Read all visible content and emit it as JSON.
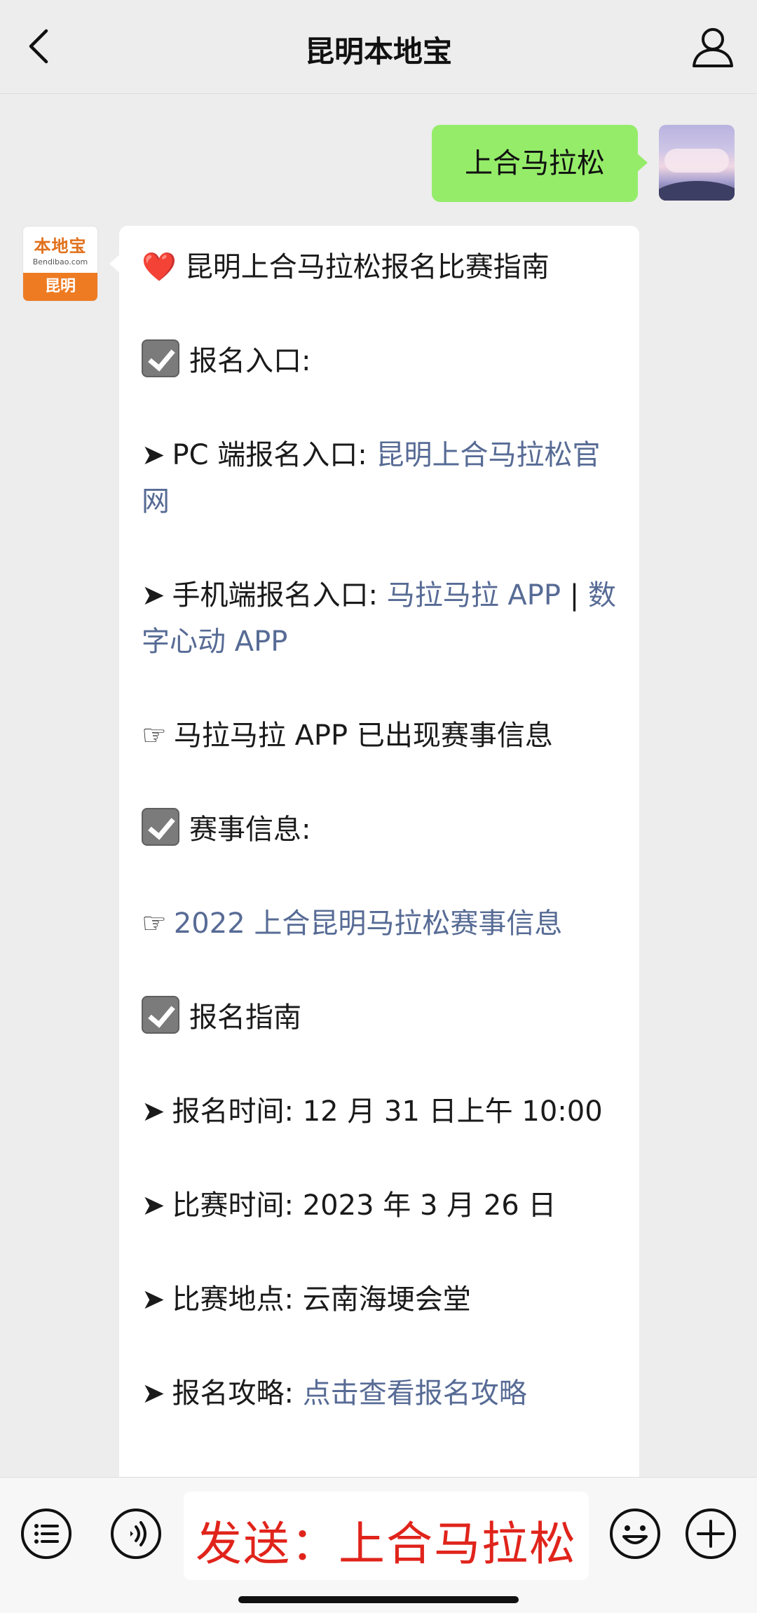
{
  "header": {
    "title": "昆明本地宝",
    "back_icon": "chevron-left-icon",
    "profile_icon": "person-icon"
  },
  "outgoing": {
    "text": "上合马拉松",
    "bubble_color": "#95ec69"
  },
  "account": {
    "avatar_logo": "本地宝",
    "avatar_site": "Bendibao.com",
    "avatar_city": "昆明",
    "brand_color": "#ee7b22"
  },
  "message": {
    "title_icon": "❤️",
    "title": "昆明上合马拉松报名比赛指南",
    "s1_heading": "报名入口:",
    "pc_label": "PC 端报名入口:",
    "pc_link": "昆明上合马拉松官网",
    "mobile_label": "手机端报名入口:",
    "mobile_link1": "马拉马拉 APP",
    "mobile_sep": "|",
    "mobile_link2": "数字心动 APP",
    "note": "马拉马拉 APP 已出现赛事信息",
    "s2_heading": "赛事信息:",
    "event_link": "2022 上合昆明马拉松赛事信息",
    "s3_heading": "报名指南",
    "reg_time_label": "报名时间:",
    "reg_time_value": "12 月 31 日上午 10:00",
    "race_time_label": "比赛时间:",
    "race_time_value": "2023 年 3 月 26 日",
    "venue_label": "比赛地点:",
    "venue_value": "云南海埂会堂",
    "guide_label": "报名攻略:",
    "guide_link": "点击查看报名攻略",
    "link_color": "#576b95"
  },
  "bottom_bar": {
    "menu_icon": "list-icon",
    "voice_icon": "voice-icon",
    "input_value": "发送：上合马拉松",
    "input_color": "#e0241b",
    "emoji_icon": "smiley-icon",
    "plus_icon": "plus-circle-icon"
  }
}
